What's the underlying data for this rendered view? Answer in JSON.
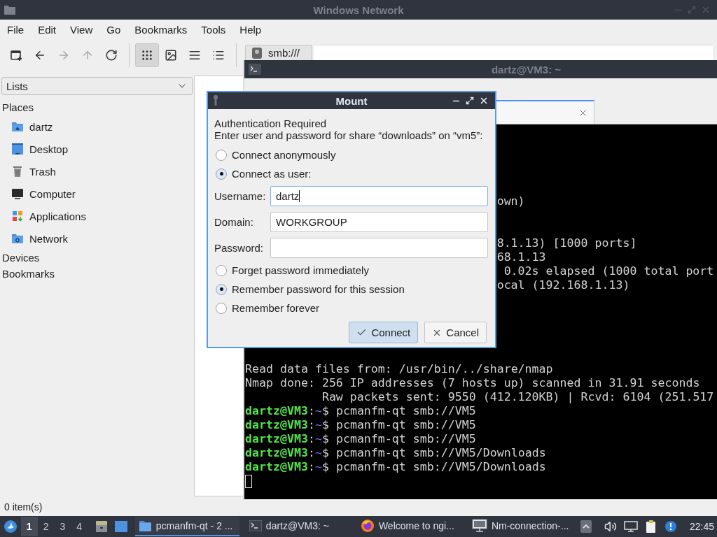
{
  "file_manager": {
    "title": "Windows Network",
    "menu": [
      "File",
      "Edit",
      "View",
      "Go",
      "Bookmarks",
      "Tools",
      "Help"
    ],
    "nav_buttons": [
      {
        "kind": "new-window",
        "disabled": false
      },
      {
        "kind": "back",
        "disabled": false
      },
      {
        "kind": "forward",
        "disabled": true
      },
      {
        "kind": "up",
        "disabled": true
      },
      {
        "kind": "reload",
        "disabled": false
      }
    ],
    "view_buttons": [
      {
        "kind": "icons",
        "selected": true
      },
      {
        "kind": "thumbnails",
        "selected": false
      },
      {
        "kind": "compact",
        "selected": false
      },
      {
        "kind": "details",
        "selected": false
      }
    ],
    "path_button": "smb:///",
    "sidebar": {
      "dropdown": "Lists",
      "sections": [
        {
          "title": "Places",
          "items": [
            {
              "label": "dartz",
              "kind": "home"
            },
            {
              "label": "Desktop",
              "kind": "desktop"
            },
            {
              "label": "Trash",
              "kind": "trash"
            },
            {
              "label": "Computer",
              "kind": "computer"
            },
            {
              "label": "Applications",
              "kind": "applications"
            },
            {
              "label": "Network",
              "kind": "network"
            }
          ]
        },
        {
          "title": "Devices"
        },
        {
          "title": "Bookmarks"
        }
      ]
    },
    "status_bar": "0 item(s)"
  },
  "terminal": {
    "title": "dartz@VM3: ~",
    "fragments": [
      "own)",
      "8.1.13) [1000 ports]",
      "68.1.13",
      " 0.02s elapsed (1000 total port",
      "ocal (192.168.1.13)"
    ],
    "lines": [
      {
        "kind": "output",
        "text": "Read data files from: /usr/bin/../share/nmap"
      },
      {
        "kind": "output",
        "text": "Nmap done: 256 IP addresses (7 hosts up) scanned in 31.91 seconds"
      },
      {
        "kind": "output",
        "text": "           Raw packets sent: 9550 (412.120KB) | Rcvd: 6104 (251.517"
      },
      {
        "kind": "prompt",
        "user": "dartz@VM3",
        "sep": ":",
        "path": "~",
        "symbol": "$",
        "command": " pcmanfm-qt smb://VM5"
      },
      {
        "kind": "prompt",
        "user": "dartz@VM3",
        "sep": ":",
        "path": "~",
        "symbol": "$",
        "command": " pcmanfm-qt smb://VM5"
      },
      {
        "kind": "prompt",
        "user": "dartz@VM3",
        "sep": ":",
        "path": "~",
        "symbol": "$",
        "command": " pcmanfm-qt smb://VM5"
      },
      {
        "kind": "prompt",
        "user": "dartz@VM3",
        "sep": ":",
        "path": "~",
        "symbol": "$",
        "command": " pcmanfm-qt smb://VM5/Downloads"
      },
      {
        "kind": "prompt",
        "user": "dartz@VM3",
        "sep": ":",
        "path": "~",
        "symbol": "$",
        "command": " pcmanfm-qt smb://VM5/Downloads"
      }
    ]
  },
  "dialog": {
    "title": "Mount",
    "heading": "Authentication Required",
    "message": "Enter user and password for share “downloads” on “vm5”:",
    "connect_options": [
      {
        "label": "Connect anonymously",
        "selected": false
      },
      {
        "label": "Connect as user:",
        "selected": true
      }
    ],
    "fields": [
      {
        "label": "Username:",
        "value": "dartz",
        "focused": true
      },
      {
        "label": "Domain:",
        "value": "WORKGROUP",
        "focused": false
      },
      {
        "label": "Password:",
        "focused": false
      }
    ],
    "remember_options": [
      {
        "label": "Forget password immediately",
        "selected": false
      },
      {
        "label": "Remember password for this session",
        "selected": true
      },
      {
        "label": "Remember forever",
        "selected": false
      }
    ],
    "buttons": [
      {
        "label": "Connect",
        "kind": "confirm",
        "default": true
      },
      {
        "label": "Cancel",
        "kind": "cancel",
        "default": false
      }
    ]
  },
  "taskbar": {
    "desktops": [
      {
        "label": "1",
        "selected": true
      },
      {
        "label": "2",
        "selected": false
      },
      {
        "label": "3",
        "selected": false
      },
      {
        "label": "4",
        "selected": false
      }
    ],
    "tasks": [
      {
        "label": "pcmanfm-qt - 2 ...",
        "kind": "folder",
        "selected": true
      },
      {
        "label": "dartz@VM3: ~",
        "kind": "terminal",
        "selected": false
      },
      {
        "label": "Welcome to ngi...",
        "kind": "browser",
        "selected": false
      },
      {
        "label": "Nm-connection-...",
        "kind": "network",
        "selected": false
      }
    ],
    "clock": "22:45"
  }
}
